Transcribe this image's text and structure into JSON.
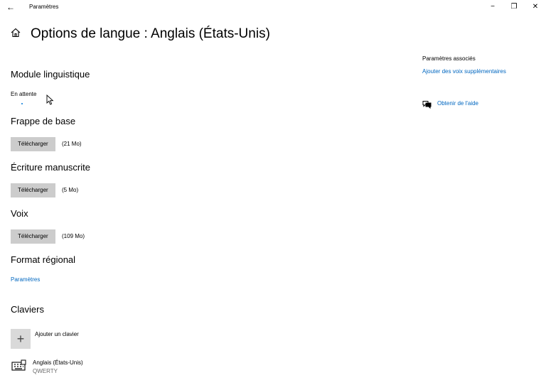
{
  "window": {
    "app_title": "Paramètres",
    "back_glyph": "←",
    "minimize_glyph": "−",
    "restore_glyph": "❐",
    "close_glyph": "✕"
  },
  "header": {
    "title": "Options de langue : Anglais (États-Unis)"
  },
  "language_pack": {
    "heading": "Module linguistique",
    "status": "En attente"
  },
  "basic_typing": {
    "heading": "Frappe de base",
    "button": "Télécharger",
    "size": "(21 Mo)"
  },
  "handwriting": {
    "heading": "Écriture manuscrite",
    "button": "Télécharger",
    "size": "(5 Mo)"
  },
  "speech": {
    "heading": "Voix",
    "button": "Télécharger",
    "size": "(109 Mo)"
  },
  "regional_format": {
    "heading": "Format régional",
    "link": "Paramètres"
  },
  "keyboards": {
    "heading": "Claviers",
    "add_label": "Ajouter un clavier",
    "add_glyph": "+",
    "items": [
      {
        "name": "Anglais (États-Unis)",
        "layout": "QWERTY"
      }
    ]
  },
  "related": {
    "heading": "Paramètres associés",
    "link": "Ajouter des voix supplémentaires"
  },
  "help": {
    "link": "Obtenir de l'aide"
  },
  "colors": {
    "accent": "#0067c0",
    "button_bg": "#cccccc",
    "progress": "#0078d7"
  }
}
